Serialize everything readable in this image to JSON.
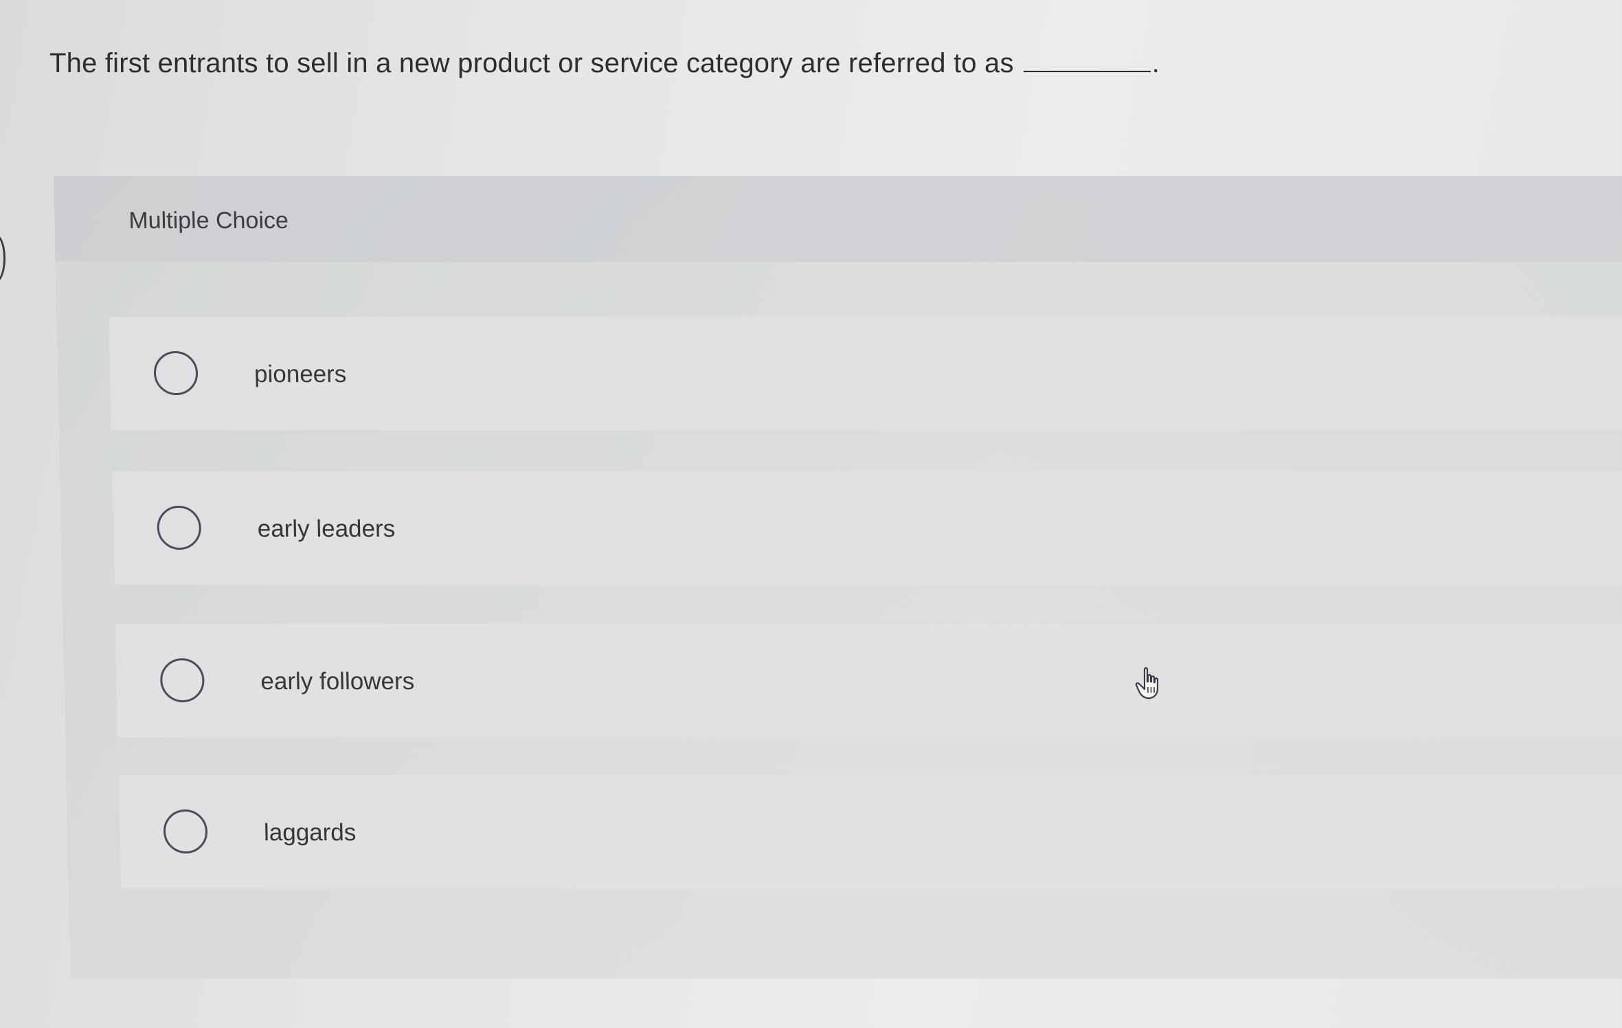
{
  "question": {
    "text": "The first entrants to sell in a new product or service category are referred to as",
    "blank_suffix": "."
  },
  "panel": {
    "title": "Multiple Choice"
  },
  "options": [
    {
      "label": "pioneers",
      "selected": false
    },
    {
      "label": "early leaders",
      "selected": false
    },
    {
      "label": "early followers",
      "selected": false
    },
    {
      "label": "laggards",
      "selected": false
    }
  ],
  "cursor": {
    "icon": "hand-pointer-icon"
  },
  "colors": {
    "background": "#e4e6e7",
    "panel": "#d0d2d4",
    "text": "#2b2d31",
    "radio_border": "#4a4d56"
  }
}
